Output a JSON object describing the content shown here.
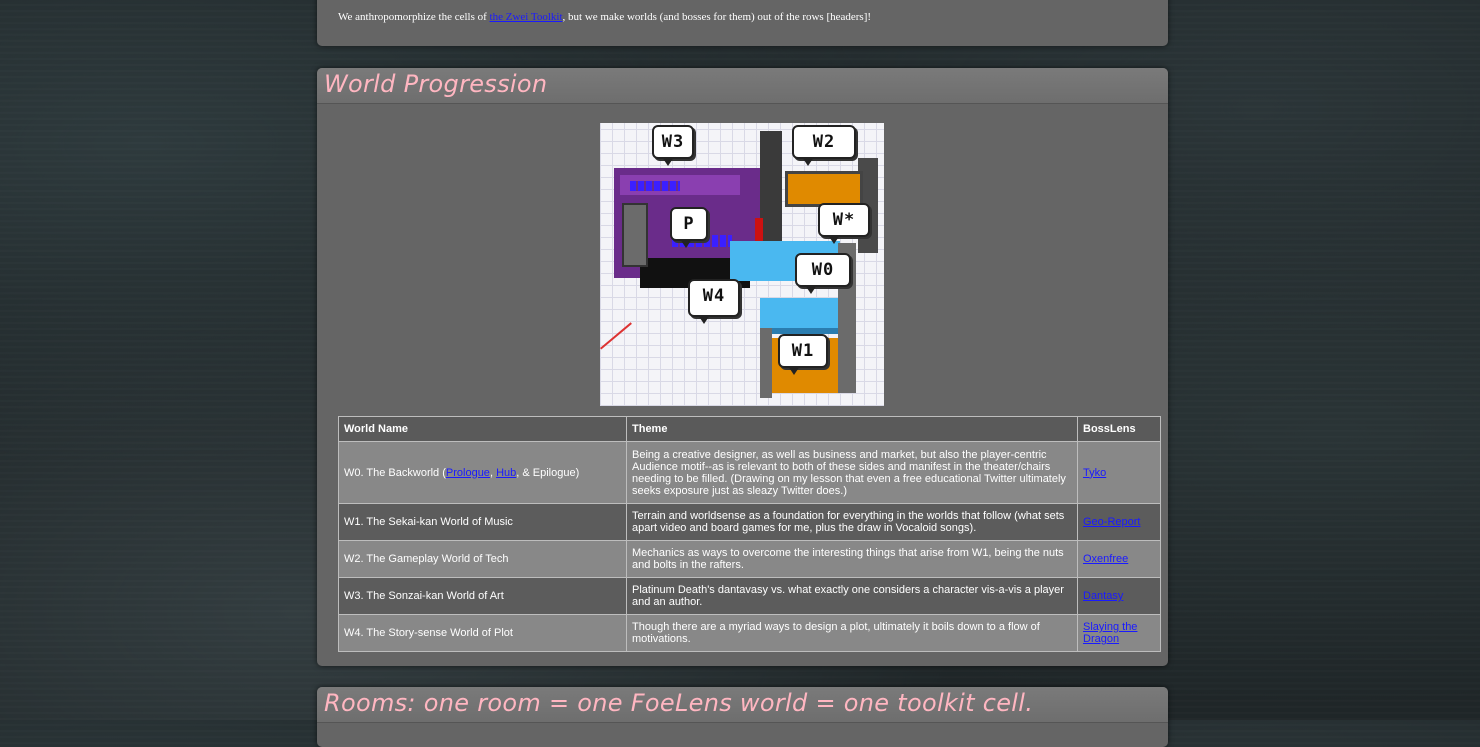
{
  "intro": {
    "text_before": "We anthropomorphize the cells of ",
    "link": "the Zwei Toolkit",
    "text_after": ", but we make worlds (and bosses for them) out of the rows [headers]!"
  },
  "world_progression": {
    "title": "World Progression",
    "image_labels": [
      "W3",
      "W2",
      "P",
      "W*",
      "W0",
      "W4",
      "W1"
    ],
    "table": {
      "headers": [
        "World Name",
        "Theme",
        "BossLens"
      ],
      "rows": [
        {
          "name_prefix": "W0. The Backworld (",
          "link1": "Prologue",
          "sep": ", ",
          "link2": "Hub",
          "name_suffix": ", & Epilogue)",
          "theme": "Being a creative designer, as well as business and market, but also the player-centric Audience motif--as is relevant to both of these sides and manifest in the theater/chairs needing to be filled. (Drawing on my lesson that even a free educational Twitter ultimately seeks exposure just as sleazy Twitter does.)",
          "boss": "Tyko"
        },
        {
          "name": "W1. The Sekai-kan World of Music",
          "theme": "Terrain and worldsense as a foundation for everything in the worlds that follow (what sets apart video and board games for me, plus the draw in Vocaloid songs).",
          "boss": "Geo-Report"
        },
        {
          "name": "W2. The Gameplay World of Tech",
          "theme": "Mechanics as ways to overcome the interesting things that arise from W1, being the nuts and bolts in the rafters.",
          "boss": "Oxenfree"
        },
        {
          "name": "W3. The Sonzai-kan World of Art",
          "theme": "Platinum Death's dantavasy vs. what exactly one considers a character vis-a-vis a player and an author.",
          "boss": "Dantasy"
        },
        {
          "name": "W4. The Story-sense World of Plot",
          "theme": "Though there are a myriad ways to design a plot, ultimately it boils down to a flow of motivations.",
          "boss": "Slaying the Dragon"
        }
      ]
    }
  },
  "rooms": {
    "title": "Rooms: one room = one FoeLens world = one toolkit cell."
  }
}
